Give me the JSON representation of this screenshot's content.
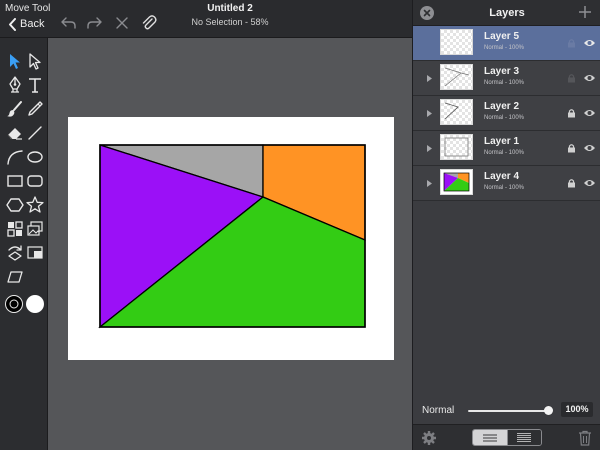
{
  "top_bar": {
    "tool_name": "Move Tool",
    "back_label": "Back",
    "document_title": "Untitled 2",
    "status": "No Selection - 58%"
  },
  "colors": {
    "accent": "#3a9ff5",
    "selected_row": "#5b6f9c",
    "shape_gray": "#a6a6a6",
    "shape_orange": "#ff9324",
    "shape_purple": "#9b10f7",
    "shape_green": "#33cc14"
  },
  "layers_panel": {
    "title": "Layers",
    "layers": [
      {
        "name": "Layer 5",
        "mode": "Normal - 100%",
        "selected": true,
        "locked": false
      },
      {
        "name": "Layer 3",
        "mode": "Normal - 100%",
        "selected": false,
        "locked": false
      },
      {
        "name": "Layer 2",
        "mode": "Normal - 100%",
        "selected": false,
        "locked": true
      },
      {
        "name": "Layer 1",
        "mode": "Normal - 100%",
        "selected": false,
        "locked": true
      },
      {
        "name": "Layer 4",
        "mode": "Normal - 100%",
        "selected": false,
        "locked": true
      }
    ],
    "blend_mode": "Normal",
    "opacity_label": "100%",
    "opacity_fraction": 1.0
  },
  "icons": {
    "toolbox": [
      "move-arrow-icon",
      "direct-select-icon",
      "pen-icon",
      "text-icon",
      "brush-icon",
      "pencil-icon",
      "eraser-icon",
      "line-icon",
      "arc-icon",
      "ellipse-icon",
      "rectangle-icon",
      "rounded-rect-icon",
      "hexagon-icon",
      "star-icon",
      "grid-icon",
      "image-stack-icon",
      "transform-icon",
      "frame-icon",
      "skew-icon",
      "stroke-color-icon",
      "fill-color-icon"
    ]
  }
}
